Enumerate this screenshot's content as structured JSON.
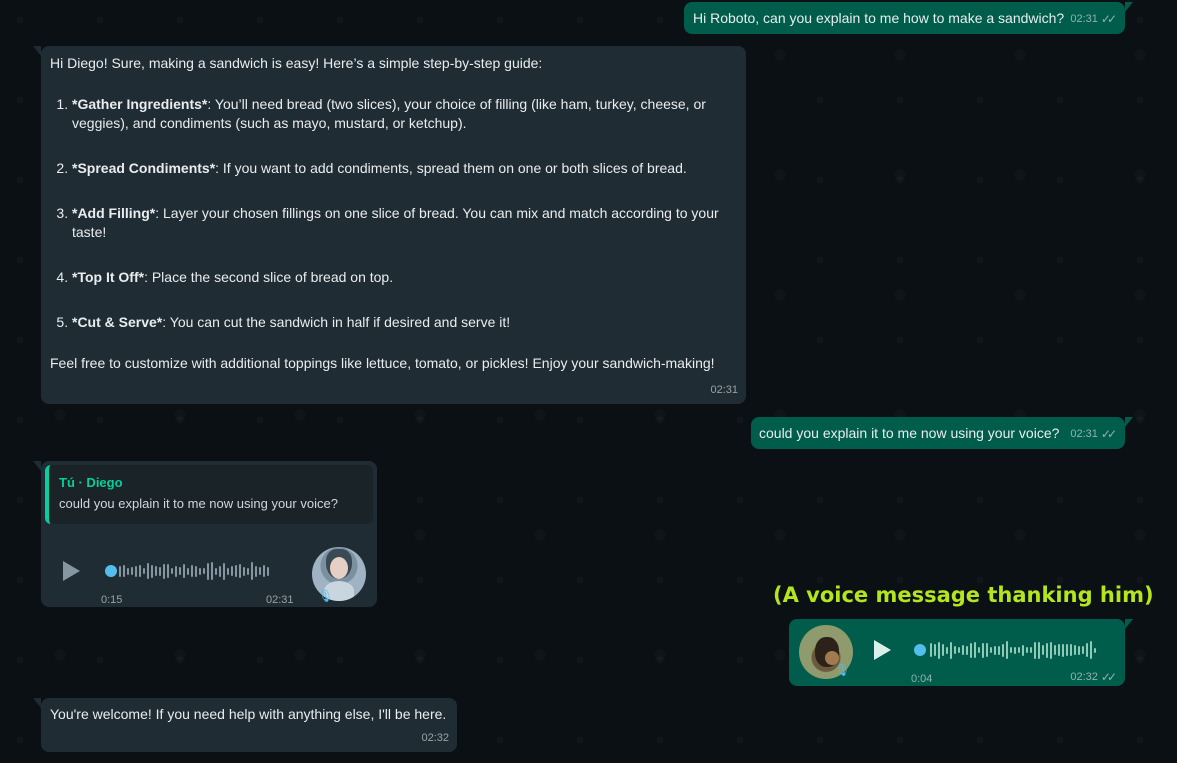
{
  "messages": {
    "m1": {
      "text": "Hi Roboto, can you explain to me how to make a sandwich?",
      "time": "02:31"
    },
    "m2": {
      "intro": "Hi Diego! Sure, making a sandwich is easy! Here’s a simple step-by-step guide:",
      "steps": [
        {
          "title": "*Gather Ingredients*",
          "text": ": You’ll need bread (two slices), your choice of filling (like ham, turkey, cheese, or veggies), and condiments (such as mayo, mustard, or ketchup)."
        },
        {
          "title": "*Spread Condiments*",
          "text": ": If you want to add condiments, spread them on one or both slices of bread."
        },
        {
          "title": "*Add Filling*",
          "text": ": Layer your chosen fillings on one slice of bread. You can mix and match according to your taste!"
        },
        {
          "title": "*Top It Off*",
          "text": ": Place the second slice of bread on top."
        },
        {
          "title": "*Cut & Serve*",
          "text": ": You can cut the sandwich in half if desired and serve it!"
        }
      ],
      "outro": "Feel free to customize with additional toppings like lettuce, tomato, or pickles! Enjoy your sandwich-making!",
      "time": "02:31"
    },
    "m3": {
      "text": "could you explain it to me now using your voice?",
      "time": "02:31"
    },
    "m4": {
      "quote_author": "Tú · Diego",
      "quote_text": "could you explain it to me now using your voice?",
      "duration": "0:15",
      "time": "02:31"
    },
    "m5": {
      "duration": "0:04",
      "time": "02:32"
    },
    "m6": {
      "text": "You're welcome! If you need help with anything else, I'll be here.",
      "time": "02:32"
    }
  },
  "annotation": "(A voice message thanking him)",
  "icons": {
    "read_receipt": "double-check-icon",
    "play": "play-icon",
    "mic": "microphone-icon"
  },
  "colors": {
    "outgoing_bubble": "#005c4b",
    "incoming_bubble": "#202c33",
    "accent": "#06cf9c",
    "annotation": "#b5e61d"
  }
}
